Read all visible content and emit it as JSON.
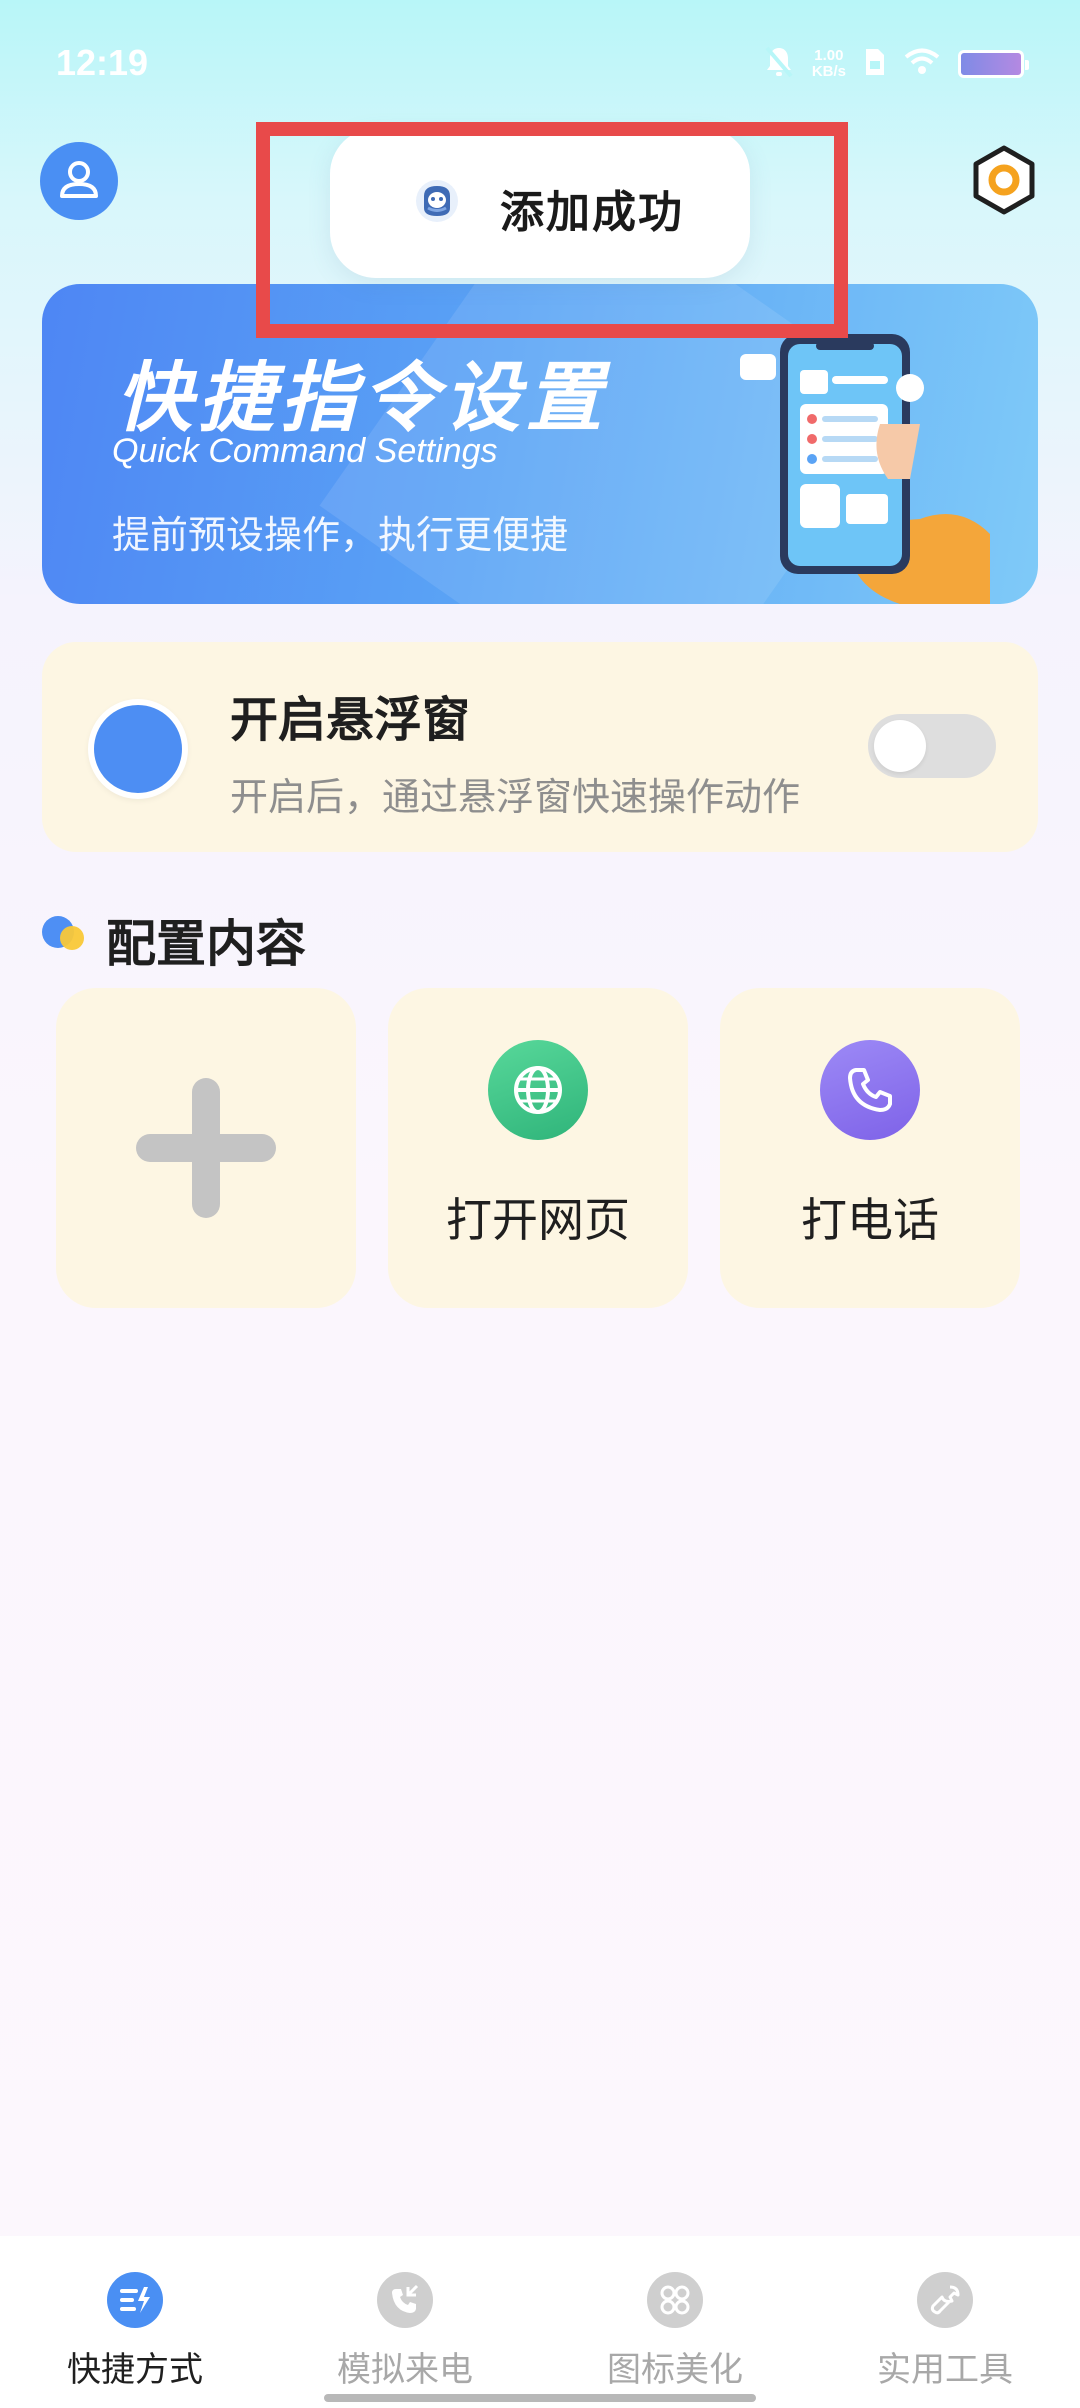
{
  "status_bar": {
    "time": "12:19",
    "net_speed_value": "1.00",
    "net_speed_unit": "KB/s",
    "icons": [
      "mute-icon",
      "sim-icon",
      "wifi-icon",
      "battery-icon"
    ]
  },
  "header": {
    "avatar_icon": "user-icon",
    "settings_icon": "hexagon-settings-icon"
  },
  "toast": {
    "text": "添加成功",
    "icon": "app-icon"
  },
  "banner": {
    "title": "快捷指令设置",
    "subtitle_en": "Quick Command Settings",
    "subtitle_cn": "提前预设操作，执行更便捷"
  },
  "floating_window": {
    "title": "开启悬浮窗",
    "description": "开启后，通过悬浮窗快速操作动作",
    "toggle_on": false
  },
  "config_section": {
    "title": "配置内容",
    "tiles": [
      {
        "label": "",
        "icon": "plus-icon"
      },
      {
        "label": "打开网页",
        "icon": "globe-icon"
      },
      {
        "label": "打电话",
        "icon": "phone-icon"
      }
    ]
  },
  "bottom_nav": {
    "items": [
      {
        "label": "快捷方式",
        "icon": "shortcut-icon",
        "active": true
      },
      {
        "label": "模拟来电",
        "icon": "incoming-call-icon",
        "active": false
      },
      {
        "label": "图标美化",
        "icon": "grid-icon",
        "active": false
      },
      {
        "label": "实用工具",
        "icon": "wrench-icon",
        "active": false
      }
    ]
  },
  "colors": {
    "accent": "#4a8ff3",
    "card_bg": "#fdf6e3",
    "highlight_border": "#e84a4a",
    "web_icon": "#3cc585",
    "call_icon": "#8a70ee"
  }
}
